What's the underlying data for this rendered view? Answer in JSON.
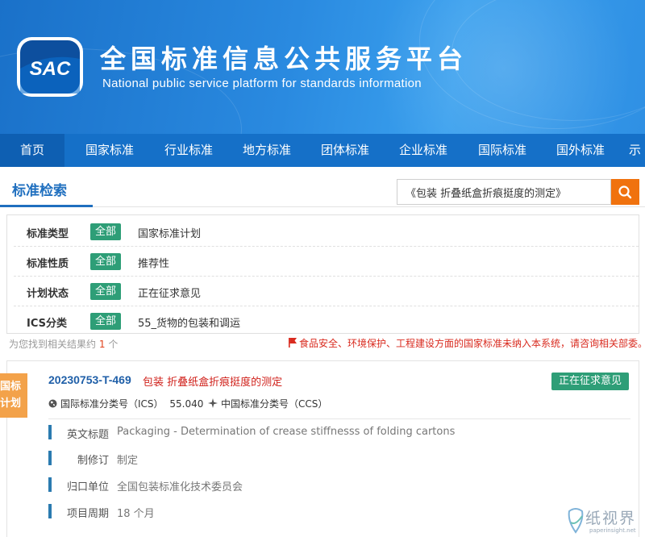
{
  "header": {
    "logo_text": "SAC",
    "title_cn": "全国标准信息公共服务平台",
    "title_en": "National public service platform  for standards information"
  },
  "nav": {
    "items": [
      {
        "label": "首页",
        "active": true
      },
      {
        "label": "国家标准"
      },
      {
        "label": "行业标准"
      },
      {
        "label": "地方标准"
      },
      {
        "label": "团体标准"
      },
      {
        "label": "企业标准"
      },
      {
        "label": "国际标准"
      },
      {
        "label": "国外标准"
      },
      {
        "label": "示"
      }
    ]
  },
  "search": {
    "section_title": "标准检索",
    "query": "《包装 折叠纸盒折痕挺度的测定》",
    "button_icon": "search-icon"
  },
  "filters": [
    {
      "label": "标准类型",
      "badge": "全部",
      "value": "国家标准计划"
    },
    {
      "label": "标准性质",
      "badge": "全部",
      "value": "推荐性"
    },
    {
      "label": "计划状态",
      "badge": "全部",
      "value": "正在征求意见"
    },
    {
      "label": "ICS分类",
      "badge": "全部",
      "value": "55_货物的包装和调运"
    }
  ],
  "results": {
    "count_prefix": "为您找到相关结果约",
    "count": "1",
    "count_suffix": "个",
    "notice": "食品安全、环境保护、工程建设方面的国家标准未纳入本系统，请咨询相关部委。"
  },
  "result_card": {
    "corner_label_line1": "国标",
    "corner_label_line2": "计划",
    "plan_number": "20230753-T-469",
    "plan_name": "包装 折叠纸盒折痕挺度的测定",
    "status": "正在征求意见",
    "ics_label": "国际标准分类号（ICS）",
    "ics_value": "55.040",
    "ccs_label": "中国标准分类号（CCS）",
    "details": [
      {
        "label": "英文标题",
        "value": "Packaging - Determination of crease stiffnesss of folding cartons"
      },
      {
        "label": "制修订",
        "value": "制定"
      },
      {
        "label": "归口单位",
        "value": "全国包装标准化技术委员会"
      },
      {
        "label": "项目周期",
        "value": "18 个月"
      }
    ]
  },
  "watermark": {
    "cn": "纸视界",
    "en": "paperinsight.net"
  },
  "colors": {
    "banner_blue": "#2a8ae0",
    "nav_blue": "#1570c8",
    "badge_green": "#2e9e77",
    "search_orange": "#f0720e",
    "corner_orange": "#f3a24a",
    "link_blue": "#1f5fa8",
    "alert_red": "#d0211b"
  }
}
